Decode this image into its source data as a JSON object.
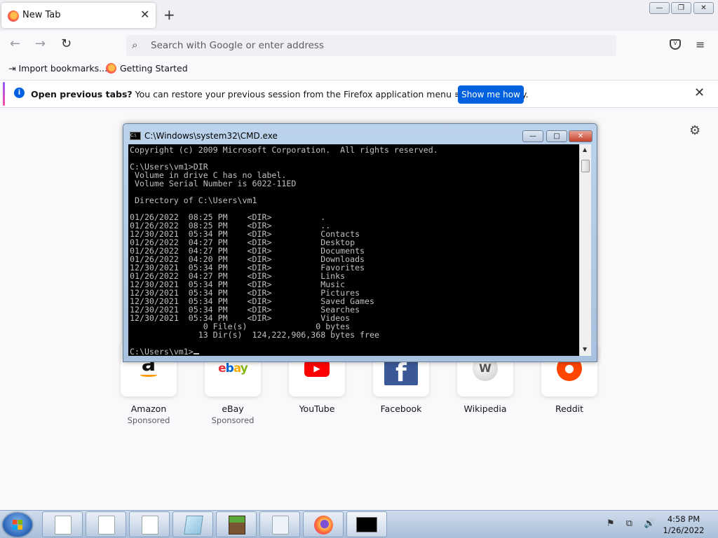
{
  "browser": {
    "tab_title": "New Tab",
    "close_tab_glyph": "✕",
    "new_tab_glyph": "+",
    "window_controls": {
      "minimize": "—",
      "maximize": "❐",
      "close": "✕"
    },
    "nav": {
      "back": "←",
      "forward": "→",
      "reload": "↻",
      "menu": "≡"
    },
    "address_placeholder": "Search with Google or enter address",
    "bookmarks": [
      {
        "label": "Import bookmarks...",
        "icon": "import-icon"
      },
      {
        "label": "Getting Started",
        "icon": "firefox-icon"
      }
    ]
  },
  "notification": {
    "bold_text": "Open previous tabs?",
    "text": " You can restore your previous session from the Firefox application menu ≡, under History.",
    "button": "Show me how",
    "close": "✕"
  },
  "settings_glyph": "⚙",
  "top_sites": [
    {
      "name": "Amazon",
      "sponsored": "Sponsored",
      "icon": "amazon-icon"
    },
    {
      "name": "eBay",
      "sponsored": "Sponsored",
      "icon": "ebay-icon"
    },
    {
      "name": "YouTube",
      "sponsored": "",
      "icon": "youtube-icon"
    },
    {
      "name": "Facebook",
      "sponsored": "",
      "icon": "facebook-icon"
    },
    {
      "name": "Wikipedia",
      "sponsored": "",
      "icon": "wikipedia-icon"
    },
    {
      "name": "Reddit",
      "sponsored": "",
      "icon": "reddit-icon"
    }
  ],
  "cmd": {
    "title": "C:\\Windows\\system32\\CMD.exe",
    "icon_text": "C:\\",
    "controls": {
      "minimize": "—",
      "maximize": "□",
      "close": "✕"
    },
    "output": "Copyright (c) 2009 Microsoft Corporation.  All rights reserved.\n\nC:\\Users\\vm1>DIR\n Volume in drive C has no label.\n Volume Serial Number is 6022-11ED\n\n Directory of C:\\Users\\vm1\n\n01/26/2022  08:25 PM    <DIR>          .\n01/26/2022  08:25 PM    <DIR>          ..\n12/30/2021  05:34 PM    <DIR>          Contacts\n01/26/2022  04:27 PM    <DIR>          Desktop\n01/26/2022  04:27 PM    <DIR>          Documents\n01/26/2022  04:20 PM    <DIR>          Downloads\n12/30/2021  05:34 PM    <DIR>          Favorites\n01/26/2022  04:27 PM    <DIR>          Links\n12/30/2021  05:34 PM    <DIR>          Music\n12/30/2021  05:34 PM    <DIR>          Pictures\n12/30/2021  05:34 PM    <DIR>          Saved Games\n12/30/2021  05:34 PM    <DIR>          Searches\n12/30/2021  05:34 PM    <DIR>          Videos\n               0 File(s)              0 bytes\n              13 Dir(s)  124,222,906,368 bytes free\n\nC:\\Users\\vm1>"
  },
  "taskbar": {
    "items": [
      "document-icon",
      "document-icon",
      "document-icon",
      "notepad-icon",
      "minecraft-icon",
      "document-icon",
      "firefox-icon",
      "cmd-icon"
    ],
    "tray": "⚑ ⧉ 🔊",
    "time": "4:58 PM",
    "date": "1/26/2022"
  }
}
